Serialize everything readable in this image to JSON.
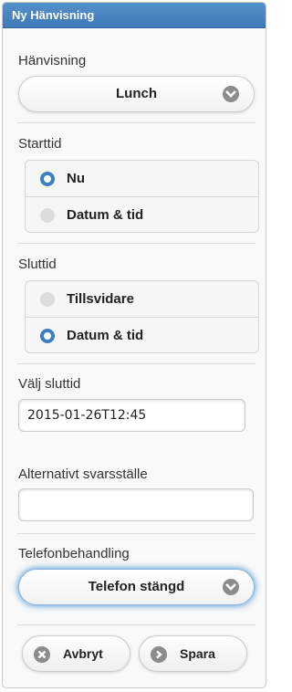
{
  "header": {
    "title": "Ny Hänvisning"
  },
  "hanvisning": {
    "label": "Hänvisning",
    "selected": "Lunch"
  },
  "starttid": {
    "label": "Starttid",
    "options": [
      {
        "label": "Nu",
        "checked": true
      },
      {
        "label": "Datum & tid",
        "checked": false
      }
    ]
  },
  "sluttid": {
    "label": "Sluttid",
    "options": [
      {
        "label": "Tillsvidare",
        "checked": false
      },
      {
        "label": "Datum & tid",
        "checked": true
      }
    ]
  },
  "valj_sluttid": {
    "label": "Välj sluttid",
    "value": "2015-01-26T12:45"
  },
  "alternativt": {
    "label": "Alternativt svarsställe",
    "value": ""
  },
  "telefonbehandling": {
    "label": "Telefonbehandling",
    "selected": "Telefon stängd"
  },
  "buttons": {
    "cancel": "Avbryt",
    "save": "Spara"
  },
  "colors": {
    "header": "#3e79b8",
    "radio_on": "#3c7dc3",
    "focus_glow": "#3388cc"
  },
  "icons": {
    "select_chevron": "chevron-down-icon",
    "cancel": "close-icon",
    "save": "chevron-right-icon"
  }
}
